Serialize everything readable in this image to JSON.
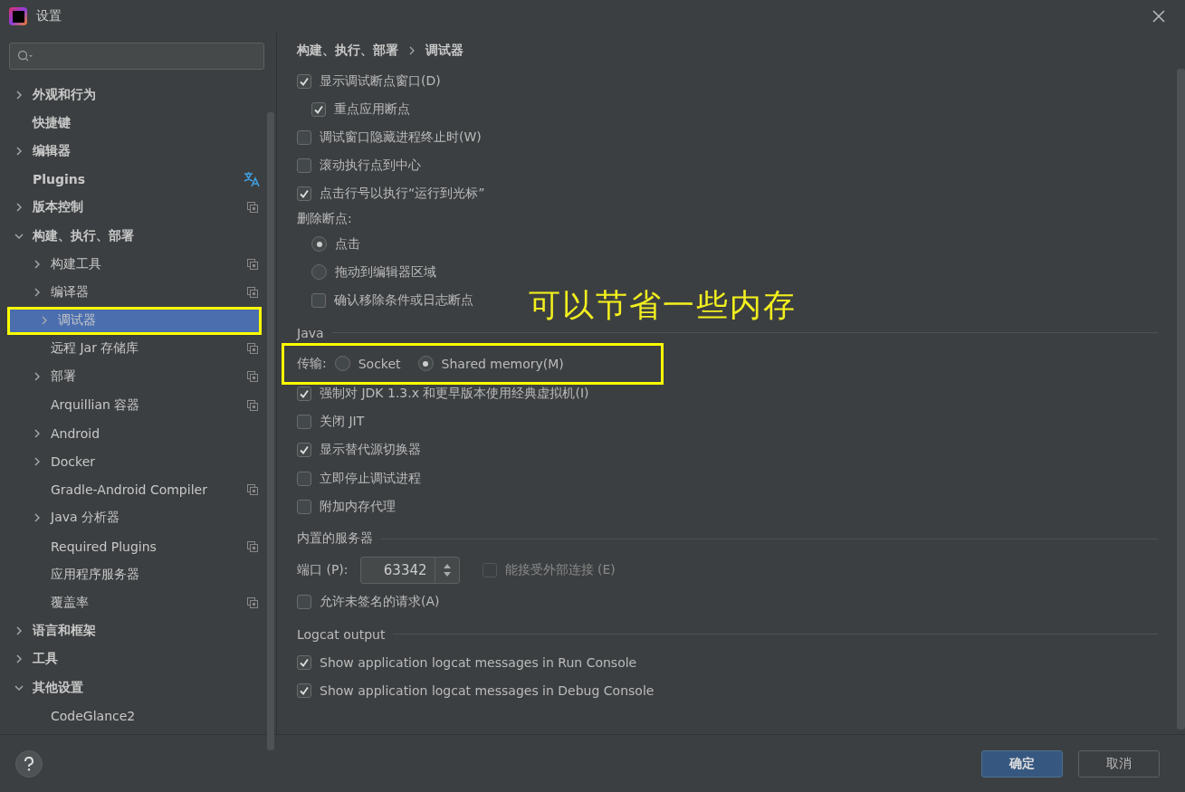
{
  "window": {
    "title": "设置"
  },
  "sidebar": {
    "items": [
      {
        "label": "外观和行为",
        "expanded": false,
        "selected": false
      },
      {
        "label": "快捷键",
        "selected": false
      },
      {
        "label": "编辑器",
        "expanded": false,
        "selected": false
      },
      {
        "label": "Plugins",
        "selected": false,
        "translatable": true
      },
      {
        "label": "版本控制",
        "expanded": false,
        "selected": false,
        "project_level": true
      },
      {
        "label": "构建、执行、部署",
        "expanded": true,
        "selected": false,
        "children": [
          {
            "label": "构建工具",
            "expanded": false,
            "selected": false,
            "project_level": true
          },
          {
            "label": "编译器",
            "expanded": false,
            "selected": false,
            "project_level": true
          },
          {
            "label": "调试器",
            "expanded": false,
            "selected": true,
            "highlighted": true
          },
          {
            "label": "远程 Jar 存储库",
            "selected": false,
            "project_level": true
          },
          {
            "label": "部署",
            "expanded": false,
            "selected": false,
            "project_level": true
          },
          {
            "label": "Arquillian 容器",
            "selected": false,
            "project_level": true
          },
          {
            "label": "Android",
            "expanded": false,
            "selected": false
          },
          {
            "label": "Docker",
            "expanded": false,
            "selected": false
          },
          {
            "label": "Gradle-Android Compiler",
            "selected": false,
            "project_level": true
          },
          {
            "label": "Java 分析器",
            "expanded": false,
            "selected": false
          },
          {
            "label": "Required Plugins",
            "selected": false,
            "project_level": true
          },
          {
            "label": "应用程序服务器",
            "selected": false
          },
          {
            "label": "覆盖率",
            "selected": false,
            "project_level": true
          }
        ]
      },
      {
        "label": "语言和框架",
        "expanded": false,
        "selected": false
      },
      {
        "label": "工具",
        "expanded": false,
        "selected": false
      },
      {
        "label": "其他设置",
        "expanded": true,
        "selected": false,
        "children": [
          {
            "label": "CodeGlance2",
            "selected": false
          }
        ]
      }
    ]
  },
  "breadcrumb": [
    "构建、执行、部署",
    "调试器"
  ],
  "rows": [
    {
      "kind": "checkbox",
      "label": "显示调试断点窗口(D)",
      "checked": true,
      "children": [
        {
          "kind": "checkbox",
          "label": "重点应用断点",
          "checked": true
        }
      ]
    },
    {
      "kind": "checkbox",
      "label": "调试窗口隐藏进程终止时(W)",
      "checked": false
    },
    {
      "kind": "checkbox",
      "label": "滚动执行点到中心",
      "checked": false
    },
    {
      "kind": "checkbox",
      "label": "点击行号以执行“运行到光标”",
      "checked": true
    },
    {
      "kind": "label",
      "label": "删除断点:",
      "children": [
        {
          "kind": "radio",
          "label": "点击",
          "selected": true
        },
        {
          "kind": "radio",
          "label": "拖动到编辑器区域",
          "selected": false
        },
        {
          "kind": "checkbox",
          "label": "确认移除条件或日志断点",
          "checked": false
        }
      ]
    },
    {
      "kind": "section",
      "label": "Java"
    },
    {
      "kind": "radio-group",
      "label": "传输:",
      "highlighted": true,
      "options": [
        {
          "label": "Socket",
          "selected": false
        },
        {
          "label": "Shared memory(M)",
          "selected": true
        }
      ]
    },
    {
      "kind": "checkbox",
      "label": "强制对 JDK 1.3.x 和更早版本使用经典虚拟机(I)",
      "checked": true
    },
    {
      "kind": "checkbox",
      "label": "关闭 JIT",
      "checked": false
    },
    {
      "kind": "checkbox",
      "label": "显示替代源切换器",
      "checked": true
    },
    {
      "kind": "checkbox",
      "label": "立即停止调试进程",
      "checked": false
    },
    {
      "kind": "checkbox",
      "label": "附加内存代理",
      "checked": false
    },
    {
      "kind": "section",
      "label": "内置的服务器"
    },
    {
      "kind": "port",
      "label": "端口 (P):",
      "value": "63342",
      "option": {
        "label": "能接受外部连接 (E)",
        "checked": false,
        "disabled": true
      }
    },
    {
      "kind": "checkbox",
      "label": "允许未签名的请求(A)",
      "checked": false
    },
    {
      "kind": "section",
      "label": "Logcat output"
    },
    {
      "kind": "checkbox",
      "label": "Show application logcat messages in Run Console",
      "checked": true
    },
    {
      "kind": "checkbox",
      "label": "Show application logcat messages in Debug Console",
      "checked": true
    }
  ],
  "annotation": {
    "text": "可以节省一些内存"
  },
  "buttons": [
    {
      "label": "确定",
      "primary": true
    },
    {
      "label": "取消",
      "primary": false
    }
  ]
}
